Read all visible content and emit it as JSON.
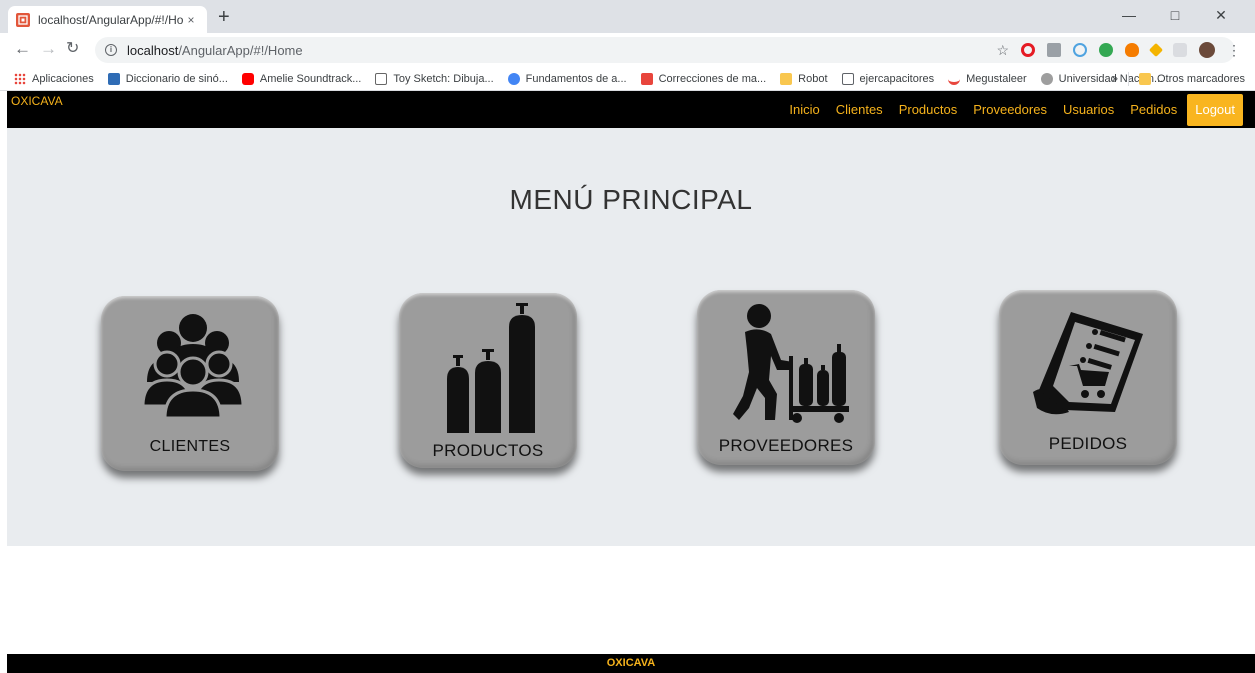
{
  "browser": {
    "tab_title": "localhost/AngularApp/#!/Home",
    "tab_close": "×",
    "new_tab": "+",
    "url_host": "localhost",
    "url_path": "/AngularApp/#!/Home",
    "bookmarks": [
      {
        "label": "Aplicaciones",
        "color": "#e8453c"
      },
      {
        "label": "Diccionario de sinó...",
        "color": "#2f6cb5"
      },
      {
        "label": "Amelie Soundtrack...",
        "color": "#ff0000"
      },
      {
        "label": "Toy Sketch: Dibuja...",
        "color": "#666666"
      },
      {
        "label": "Fundamentos de a...",
        "color": "#4285f4"
      },
      {
        "label": "Correcciones de ma...",
        "color": "#e8453c"
      },
      {
        "label": "Robot",
        "color": "#f9c74f"
      },
      {
        "label": "ejercapacitores",
        "color": "#ffffff"
      },
      {
        "label": "Megustaleer",
        "color": "#e8453c"
      },
      {
        "label": "Universidad Nacion...",
        "color": "#888888"
      }
    ],
    "bookmarks_overflow": "»",
    "other_bookmarks": "Otros marcadores"
  },
  "app": {
    "brand": "OXICAVA",
    "nav": [
      "Inicio",
      "Clientes",
      "Productos",
      "Proveedores",
      "Usuarios",
      "Pedidos"
    ],
    "logout": "Logout",
    "title": "MENÚ PRINCIPAL",
    "cards": [
      {
        "label": "CLIENTES",
        "icon": "people-group-icon"
      },
      {
        "label": "PRODUCTOS",
        "icon": "gas-cylinders-icon"
      },
      {
        "label": "PROVEEDORES",
        "icon": "worker-trolley-icon"
      },
      {
        "label": "PEDIDOS",
        "icon": "order-cart-icon"
      }
    ],
    "footer": "OXICAVA"
  },
  "colors": {
    "accent": "#f5b21c",
    "nav_bg": "#000000",
    "page_bg": "#e9ecef",
    "card_bg": "#9c9c9c"
  }
}
